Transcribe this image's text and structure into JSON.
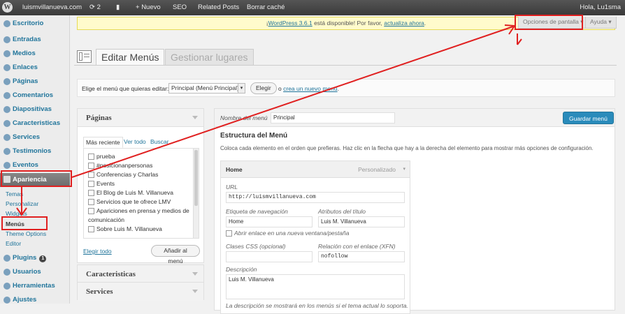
{
  "adminbar": {
    "site": "luismvillanueva.com",
    "updates": "2",
    "new": "Nuevo",
    "seo": "SEO",
    "related": "Related Posts",
    "cache": "Borrar caché",
    "greeting": "Hola, Lu1sma"
  },
  "sidebar": {
    "items": [
      {
        "label": "Escritorio"
      },
      {
        "label": "Entradas"
      },
      {
        "label": "Medios"
      },
      {
        "label": "Enlaces"
      },
      {
        "label": "Páginas"
      },
      {
        "label": "Comentarios"
      },
      {
        "label": "Diapositivas"
      },
      {
        "label": "Caracteristicas"
      },
      {
        "label": "Services"
      },
      {
        "label": "Testimonios"
      },
      {
        "label": "Eventos"
      },
      {
        "label": "Apariencia"
      },
      {
        "label": "Plugins"
      },
      {
        "label": "Usuarios"
      },
      {
        "label": "Herramientas"
      },
      {
        "label": "Ajustes"
      }
    ],
    "subitems": [
      "Temas",
      "Personalizar",
      "Widgets",
      "Menús",
      "Theme Options",
      "Editor"
    ],
    "plugins_badge": "1"
  },
  "notice": {
    "prefix": "¡",
    "link1": "WordPress 3.6.1",
    "middle": " está disponible! Por favor, ",
    "link2": "actualiza ahora",
    "suffix": "."
  },
  "screen_options": "Opciones de pantalla",
  "help": "Ayuda",
  "tabs": [
    "Editar Menús",
    "Gestionar lugares"
  ],
  "select_menu": {
    "label": "Elige el menú que quieras editar:",
    "value": "Principal (Menú Principal)",
    "button": "Elegir",
    "or": "o",
    "create_link": "crea un nuevo menú",
    "period": "."
  },
  "pages_box": {
    "title": "Páginas",
    "tabs": [
      "Más reciente",
      "Ver todo",
      "Buscar"
    ],
    "items": [
      "prueba",
      "#posicionanpersonas",
      "Conferencias y Charlas",
      "Events",
      "El Blog de Luis M. Villanueva",
      "Servicios que te ofrece LMV",
      "Apariciones en prensa y medios de",
      "comunicación",
      "Sobre Luis M. Villanueva"
    ],
    "select_all": "Elegir todo",
    "add_button": "Añadir al menú"
  },
  "collapsed_boxes": [
    "Caracteristicas",
    "Services"
  ],
  "menu_editor": {
    "name_label": "Nombre del menú",
    "name_value": "Principal",
    "save_button": "Guardar menú",
    "structure_title": "Estructura del Menú",
    "structure_desc": "Coloca cada elemento en el orden que prefieras. Haz clic en la flecha que hay a la derecha del elemento para mostrar más opciones de configuración.",
    "item": {
      "title": "Home",
      "type": "Personalizado",
      "url_label": "URL",
      "url_value": "http://luismvillanueva.com",
      "nav_label": "Etiqueta de navegación",
      "nav_value": "Home",
      "title_attr_label": "Atributos del título",
      "title_attr_value": "Luis M. Villanueva",
      "new_window": "Abrir enlace en una nueva ventana/pestaña",
      "css_label": "Clases CSS (opcional)",
      "css_value": "",
      "xfn_label": "Relación con el enlace (XFN)",
      "xfn_value": "nofollow",
      "desc_label": "Descripción",
      "desc_value": "Luis M. Villanueva",
      "desc_help": "La descripción se mostrará en los menús si el tema actual lo soporta."
    }
  },
  "colors": {
    "annotation": "#e02020",
    "primary": "#21759b",
    "adminbar": "#464646"
  }
}
